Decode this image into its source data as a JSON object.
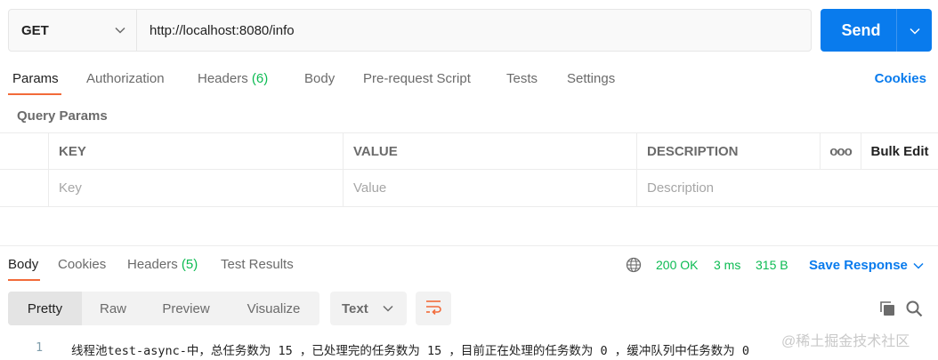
{
  "request": {
    "method": "GET",
    "url": "http://localhost:8080/info",
    "send_label": "Send"
  },
  "request_tabs": {
    "params": "Params",
    "authorization": "Authorization",
    "headers": "Headers",
    "headers_count": "(6)",
    "body": "Body",
    "prerequest": "Pre-request Script",
    "tests": "Tests",
    "settings": "Settings",
    "cookies": "Cookies"
  },
  "query_params": {
    "title": "Query Params",
    "columns": {
      "key": "KEY",
      "value": "VALUE",
      "description": "DESCRIPTION",
      "more": "ooo",
      "bulk_edit": "Bulk Edit"
    },
    "placeholders": {
      "key": "Key",
      "value": "Value",
      "description": "Description"
    }
  },
  "response_tabs": {
    "body": "Body",
    "cookies": "Cookies",
    "headers": "Headers",
    "headers_count": "(5)",
    "test_results": "Test Results"
  },
  "response_meta": {
    "status": "200 OK",
    "time": "3 ms",
    "size": "315 B",
    "save_response": "Save Response"
  },
  "response_view": {
    "modes": [
      "Pretty",
      "Raw",
      "Preview",
      "Visualize"
    ],
    "format": "Text"
  },
  "response_body": {
    "line_number": "1",
    "text": "线程池test-async-中，总任务数为 15 ，已处理完的任务数为 15 ，目前正在处理的任务数为 0 ，缓冲队列中任务数为 0"
  },
  "watermark": "@稀土掘金技术社区",
  "colors": {
    "accent": "#097bed",
    "active_tab": "#f26b3a",
    "success": "#0cbb52"
  },
  "icons": [
    "chevron-down-icon",
    "globe-icon",
    "wrap-lines-icon",
    "copy-icon",
    "search-icon"
  ]
}
